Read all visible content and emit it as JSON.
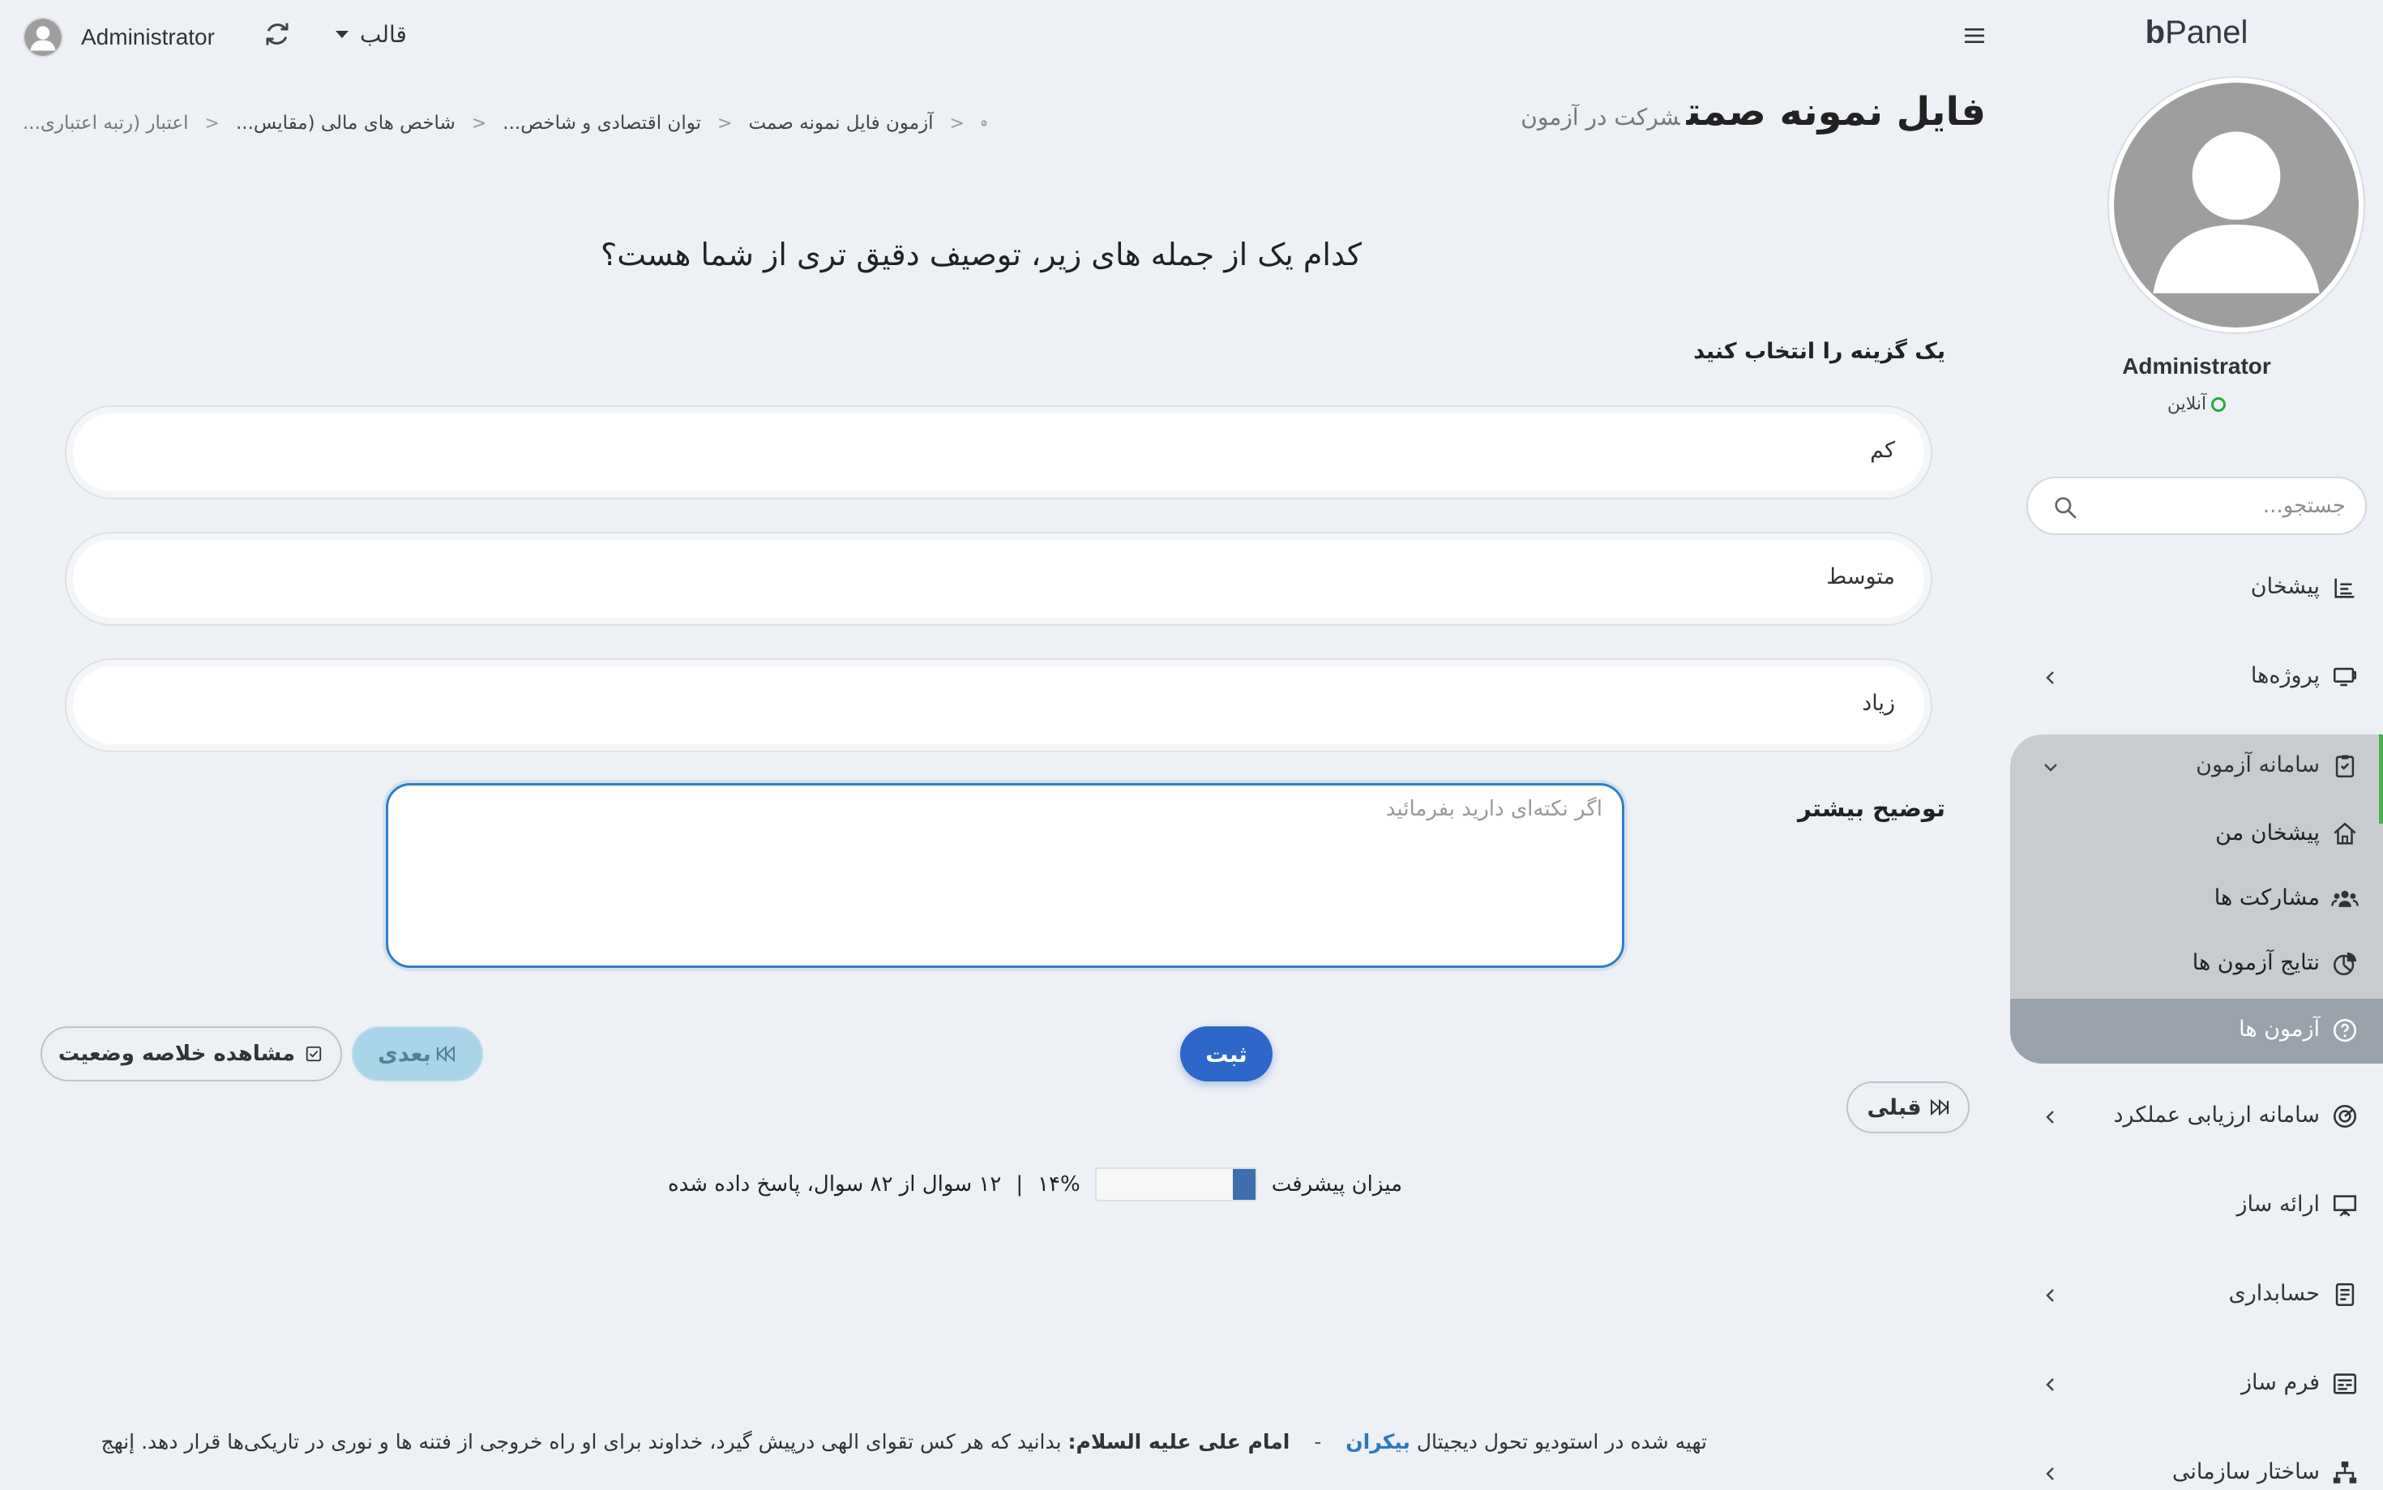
{
  "sidebar": {
    "brand_bold": "b",
    "brand_rest": "Panel",
    "user_name": "Administrator",
    "user_status": "آنلاین",
    "search_placeholder": "جستجو...",
    "items": [
      {
        "label": "پیشخان",
        "icon": "dashboard-icon"
      },
      {
        "label": "پروژه‌ها",
        "icon": "projects-icon"
      },
      {
        "label": "سامانه آزمون",
        "icon": "clipboard-icon"
      },
      {
        "label": "پیشخان من",
        "icon": "home-icon"
      },
      {
        "label": "مشارکت ها",
        "icon": "users-icon"
      },
      {
        "label": "نتایج آزمون ها",
        "icon": "pie-chart-icon"
      },
      {
        "label": "آزمون ها",
        "icon": "question-icon"
      },
      {
        "label": "سامانه ارزیابی عملکرد",
        "icon": "gauge-icon"
      },
      {
        "label": "ارائه ساز",
        "icon": "presentation-icon"
      },
      {
        "label": "حسابداری",
        "icon": "ledger-icon"
      },
      {
        "label": "فرم ساز",
        "icon": "form-icon"
      },
      {
        "label": "ساختار سازمانی",
        "icon": "org-chart-icon"
      }
    ]
  },
  "topbar": {
    "user_name": "Administrator",
    "template_label": "قالب"
  },
  "header": {
    "title": "فایل نمونه صمت",
    "subtitle": "شرکت در آزمون"
  },
  "breadcrumb": [
    "آزمون فایل نمونه صمت",
    "توان اقتصادی و شاخص...",
    "شاخص های مالی (مقایس...",
    "اعتبار (رتبه اعتباری..."
  ],
  "question": {
    "text": "کدام یک از جمله های زیر، توصیف دقیق تری از شما هست؟",
    "choose_label": "یک گزینه را انتخاب کنید",
    "options": [
      "کم",
      "متوسط",
      "زیاد"
    ],
    "more_label": "توضیح بیشتر",
    "more_placeholder": "اگر نکته‌ای دارید بفرمائید"
  },
  "buttons": {
    "submit": "ثبت",
    "next": "بعدی",
    "summary": "مشاهده خلاصه وضعیت",
    "prev": "قبلی"
  },
  "progress": {
    "label": "میزان پیشرفت",
    "percent_text": "۱۴%",
    "value": 0.14,
    "separator": "|",
    "answered_text": "۱۲ سوال از ۸۲ سوال، پاسخ داده شده"
  },
  "footer": {
    "prefix": "تهیه شده در استودیو تحول دیجیتال",
    "link": "بیکران",
    "dash": "-",
    "quote_author": "امام علی علیه السلام:",
    "quote": "بدانید که هر کس تقوای الهی درپیش گیرد، خداوند برای او راه خروجی از فتنه ها و نوری در تاریکی‌ها قرار دهد. إنهج"
  },
  "colors": {
    "primary": "#2d67c9",
    "accent_green": "#4caf50",
    "link": "#2b78c2",
    "progress_fill": "#3d6fb0"
  }
}
